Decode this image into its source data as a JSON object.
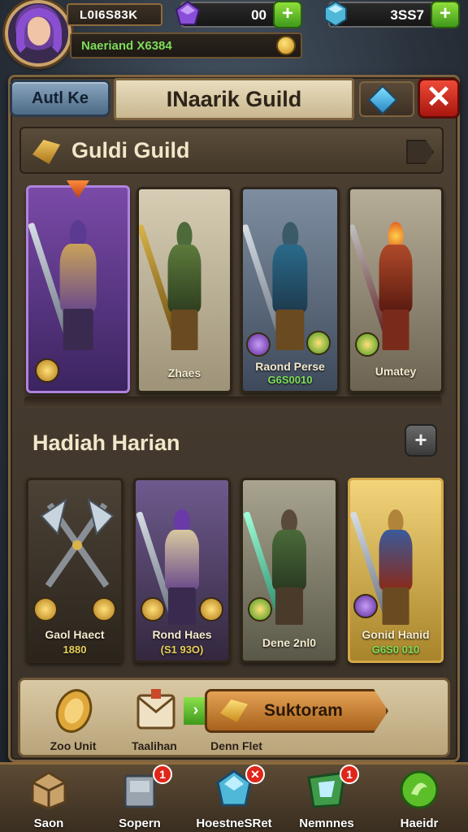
{
  "hud": {
    "player_name": "L0I6S83K",
    "player_sub": "Naeriand X6384",
    "gems_value": "00",
    "crystals_value": "3SS7",
    "plus": "+"
  },
  "header": {
    "back_label": "Autl Ke",
    "title": "INaarik Guild",
    "close": "✕"
  },
  "guild_section": {
    "title": "Guldi Guild",
    "heroes": [
      {
        "label": "",
        "sub": ""
      },
      {
        "label": "Zhaes",
        "sub": ""
      },
      {
        "label": "Raond Perse",
        "sub": "G6S0010"
      },
      {
        "label": "Umatey",
        "sub": ""
      }
    ]
  },
  "daily_section": {
    "title": "Hadiah Harian",
    "plus": "+",
    "rewards": [
      {
        "label": "Gaol Haect",
        "sub": "1880"
      },
      {
        "label": "Rond Haes",
        "sub": "(S1 93O)"
      },
      {
        "label": "Dene 2nl0",
        "sub": ""
      },
      {
        "label": "Gonid Hanid",
        "sub": "G6S0 010"
      }
    ]
  },
  "reward_bar": {
    "item1": "Zoo Unit",
    "item2": "Taalihan",
    "item3": "Denn Flet",
    "claim_label": "Suktoram",
    "arrow": "›"
  },
  "bottom_nav": [
    {
      "label": "Saon",
      "badge": ""
    },
    {
      "label": "Sopern",
      "badge": "1"
    },
    {
      "label": "HoestneSRet",
      "badge": "✕"
    },
    {
      "label": "Nemnnes",
      "badge": "1"
    },
    {
      "label": "Haeidr",
      "badge": ""
    }
  ],
  "colors": {
    "accent_gold": "#c9a36a",
    "close_red": "#d32b1d",
    "plus_green": "#5cbf2a",
    "panel_brown": "#433829"
  }
}
